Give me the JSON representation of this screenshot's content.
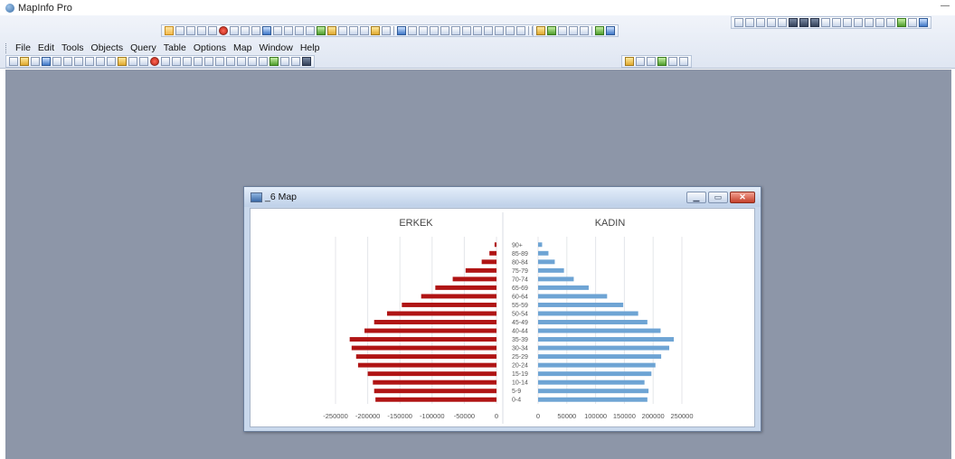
{
  "app": {
    "title": "MapInfo Pro",
    "minimize_label": "—"
  },
  "menu": [
    "File",
    "Edit",
    "Tools",
    "Objects",
    "Query",
    "Table",
    "Options",
    "Map",
    "Window",
    "Help"
  ],
  "map_window": {
    "title": "_6 Map",
    "minimize_label": "▁",
    "restore_label": "▭",
    "close_label": "✕"
  },
  "colors": {
    "male": "#b01414",
    "female": "#6ea4d4",
    "workspace": "#8d96a8"
  },
  "chart_data": {
    "type": "bar",
    "orientation": "horizontal",
    "categories": [
      "0-4",
      "5-9",
      "10-14",
      "15-19",
      "20-24",
      "25-29",
      "30-34",
      "35-39",
      "40-44",
      "45-49",
      "50-54",
      "55-59",
      "60-64",
      "65-69",
      "70-74",
      "75-79",
      "80-84",
      "85-89",
      "90+"
    ],
    "panels": [
      {
        "title": "ERKEK",
        "xlim": [
          -250000,
          0
        ],
        "ticks": [
          -250000,
          -200000,
          -150000,
          -100000,
          -50000,
          0
        ],
        "tick_labels": [
          "-250000",
          "-200000",
          "-150000",
          "-100000",
          "-50000",
          "0"
        ],
        "values": [
          -188000,
          -190000,
          -192000,
          -200000,
          -215000,
          -218000,
          -225000,
          -228000,
          -205000,
          -190000,
          -170000,
          -147000,
          -117000,
          -95000,
          -68000,
          -48000,
          -23000,
          -11000,
          -3000
        ]
      },
      {
        "title": "KADIN",
        "xlim": [
          0,
          250000
        ],
        "ticks": [
          0,
          50000,
          100000,
          150000,
          200000,
          250000
        ],
        "tick_labels": [
          "0",
          "50000",
          "100000",
          "150000",
          "200000",
          "250000"
        ],
        "values": [
          190000,
          192000,
          185000,
          197000,
          204000,
          214000,
          228000,
          236000,
          213000,
          190000,
          174000,
          148000,
          120000,
          88000,
          62000,
          45000,
          29000,
          18000,
          7000
        ]
      }
    ],
    "grid": true,
    "legend": "none"
  }
}
